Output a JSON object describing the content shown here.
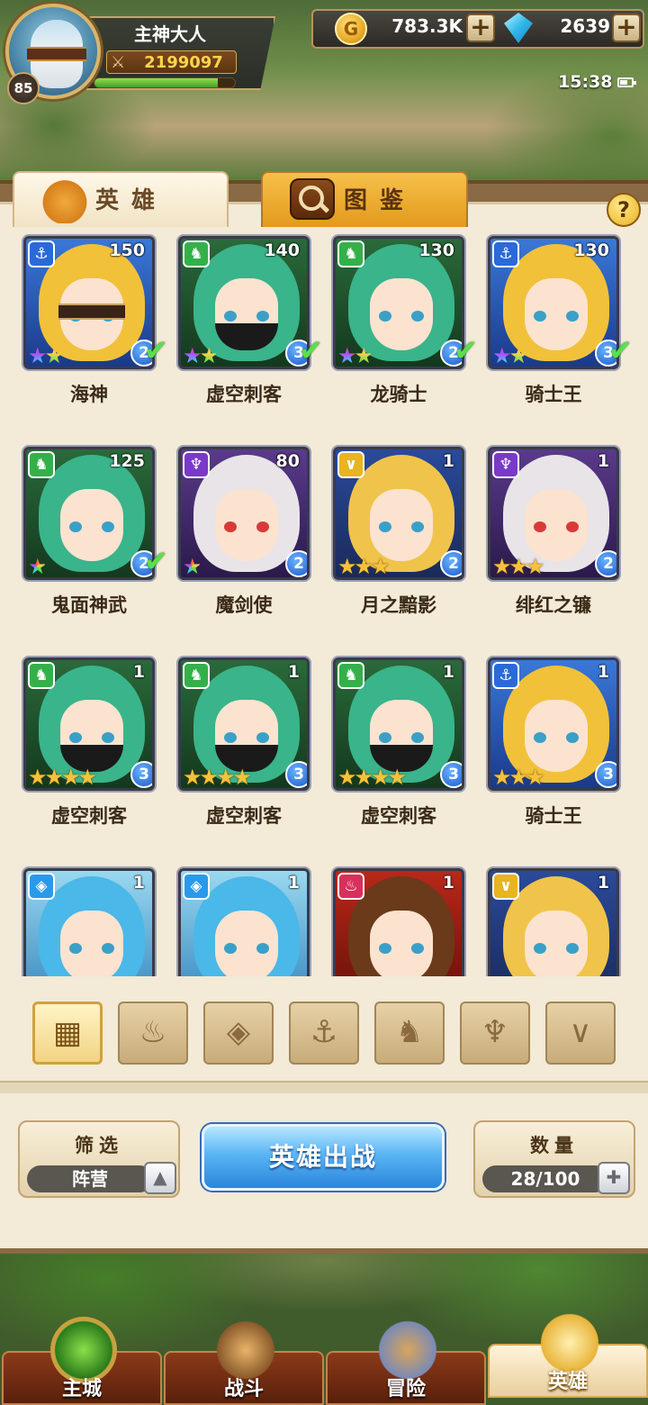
{
  "player": {
    "name": "主神大人",
    "level": "85",
    "power": "2199097",
    "exp_fraction": 0.88
  },
  "resources": {
    "gold": "783.3K",
    "gems": "2639"
  },
  "status": {
    "time": "15:38"
  },
  "tabs": [
    {
      "label": "英雄"
    },
    {
      "label": "图鉴"
    }
  ],
  "help_label": "?",
  "heroes": [
    {
      "name": "海神",
      "level": "150",
      "faction": "anchor",
      "stars": "★★",
      "star_rainbow": true,
      "tier": "2",
      "deployed": true
    },
    {
      "name": "虚空刺客",
      "level": "140",
      "faction": "beast",
      "stars": "★★",
      "star_rainbow": true,
      "tier": "3",
      "deployed": true
    },
    {
      "name": "龙骑士",
      "level": "130",
      "faction": "beast",
      "stars": "★★",
      "star_rainbow": true,
      "tier": "2",
      "deployed": true
    },
    {
      "name": "骑士王",
      "level": "130",
      "faction": "anchor",
      "stars": "★★",
      "star_rainbow": true,
      "tier": "3",
      "deployed": true
    },
    {
      "name": "鬼面神武",
      "level": "125",
      "faction": "beast",
      "stars": "★",
      "star_rainbow": true,
      "tier": "2",
      "deployed": true
    },
    {
      "name": "魔剑使",
      "level": "80",
      "faction": "demon",
      "stars": "★",
      "star_rainbow": true,
      "tier": "2",
      "deployed": false
    },
    {
      "name": "月之黯影",
      "level": "1",
      "faction": "light",
      "stars": "★★★",
      "star_rainbow": false,
      "tier": "2",
      "deployed": false
    },
    {
      "name": "绯红之镰",
      "level": "1",
      "faction": "demon",
      "stars": "★★★",
      "star_rainbow": false,
      "tier": "2",
      "deployed": false
    },
    {
      "name": "虚空刺客",
      "level": "1",
      "faction": "beast",
      "stars": "★★★★",
      "star_rainbow": false,
      "tier": "3",
      "deployed": false
    },
    {
      "name": "虚空刺客",
      "level": "1",
      "faction": "beast",
      "stars": "★★★★",
      "star_rainbow": false,
      "tier": "3",
      "deployed": false
    },
    {
      "name": "虚空刺客",
      "level": "1",
      "faction": "beast",
      "stars": "★★★★",
      "star_rainbow": false,
      "tier": "3",
      "deployed": false
    },
    {
      "name": "骑士王",
      "level": "1",
      "faction": "anchor",
      "stars": "★★★",
      "star_rainbow": false,
      "tier": "3",
      "deployed": false
    },
    {
      "name": "",
      "level": "1",
      "faction": "water",
      "stars": "",
      "star_rainbow": false,
      "tier": "",
      "deployed": false
    },
    {
      "name": "",
      "level": "1",
      "faction": "water",
      "stars": "",
      "star_rainbow": false,
      "tier": "",
      "deployed": false
    },
    {
      "name": "",
      "level": "1",
      "faction": "fire",
      "stars": "",
      "star_rainbow": false,
      "tier": "",
      "deployed": false
    },
    {
      "name": "",
      "level": "1",
      "faction": "light",
      "stars": "",
      "star_rainbow": false,
      "tier": "",
      "deployed": false
    }
  ],
  "faction_colors": {
    "anchor": "#2a6ad8",
    "beast": "#34b04a",
    "demon": "#7a3ac8",
    "light": "#e8b420",
    "water": "#2a9ae8",
    "fire": "#d8305a"
  },
  "filters": [
    {
      "icon": "grid-icon",
      "glyph": "▦",
      "active": true
    },
    {
      "icon": "fire-icon",
      "glyph": "♨",
      "active": false
    },
    {
      "icon": "water-icon",
      "glyph": "◈",
      "active": false
    },
    {
      "icon": "anchor-icon",
      "glyph": "⚓",
      "active": false
    },
    {
      "icon": "beast-icon",
      "glyph": "♞",
      "active": false
    },
    {
      "icon": "demon-icon",
      "glyph": "♆",
      "active": false
    },
    {
      "icon": "light-icon",
      "glyph": "∨",
      "active": false
    }
  ],
  "actions": {
    "filter_title": "筛选",
    "filter_value": "阵营",
    "deploy_label": "英雄出战",
    "count_title": "数量",
    "count_value": "28/100"
  },
  "nav": [
    {
      "label": "主城",
      "icon": "city-icon",
      "active": false
    },
    {
      "label": "战斗",
      "icon": "crossed-swords-icon",
      "active": false
    },
    {
      "label": "冒险",
      "icon": "map-icon",
      "active": false
    },
    {
      "label": "英雄",
      "icon": "hero-crest-icon",
      "active": true
    }
  ]
}
